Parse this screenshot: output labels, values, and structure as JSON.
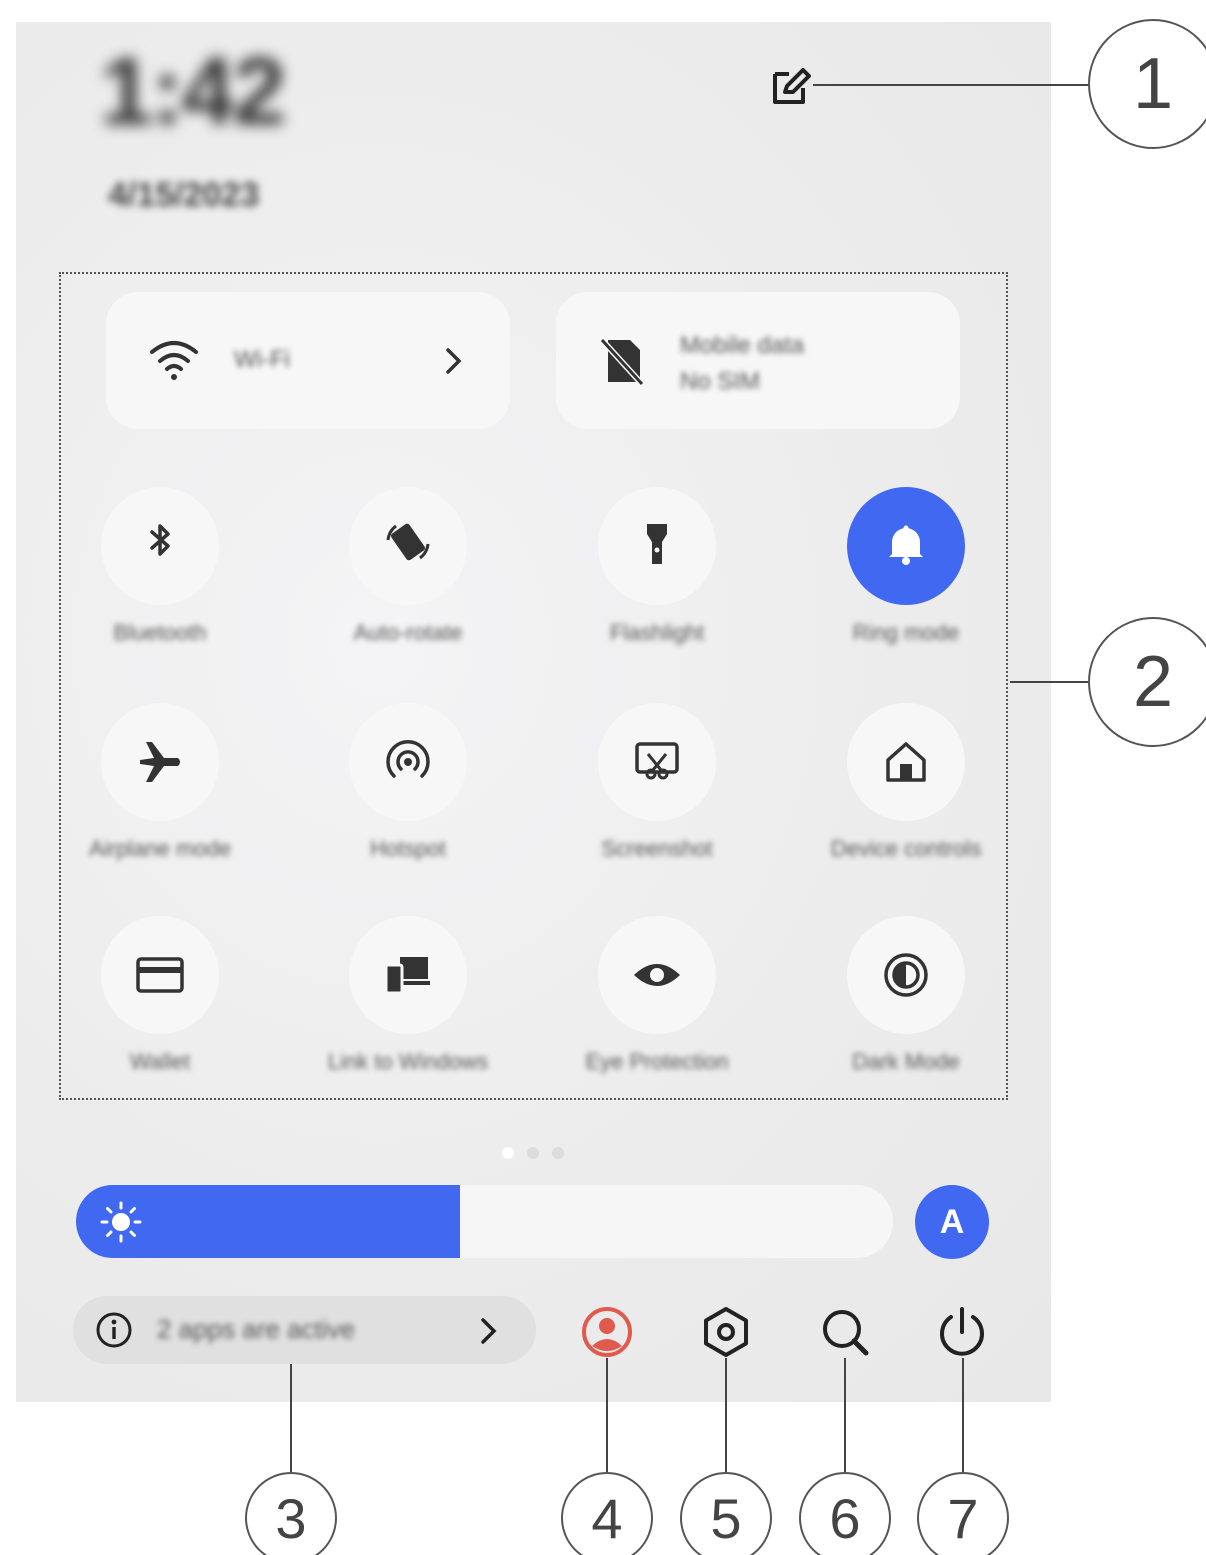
{
  "status": {
    "time": "1:42",
    "date": "4/15/2023"
  },
  "tiles": {
    "wifi": {
      "label": "Wi-Fi",
      "icon": "wifi-icon"
    },
    "mobile": {
      "line1": "Mobile data",
      "line2": "No SIM",
      "icon": "no-sim-icon"
    }
  },
  "toggles": [
    {
      "label": "Bluetooth",
      "icon": "bluetooth-icon",
      "active": false
    },
    {
      "label": "Auto-rotate",
      "icon": "auto-rotate-icon",
      "active": false
    },
    {
      "label": "Flashlight",
      "icon": "flashlight-icon",
      "active": false
    },
    {
      "label": "Ring mode",
      "icon": "bell-icon",
      "active": true
    },
    {
      "label": "Airplane mode",
      "icon": "airplane-icon",
      "active": false
    },
    {
      "label": "Hotspot",
      "icon": "hotspot-icon",
      "active": false
    },
    {
      "label": "Screenshot",
      "icon": "screenshot-icon",
      "active": false
    },
    {
      "label": "Device controls",
      "icon": "home-icon",
      "active": false
    },
    {
      "label": "Wallet",
      "icon": "wallet-icon",
      "active": false
    },
    {
      "label": "Link to Windows",
      "icon": "link-devices-icon",
      "active": false
    },
    {
      "label": "Eye Protection",
      "icon": "eye-icon",
      "active": false
    },
    {
      "label": "Dark Mode",
      "icon": "contrast-icon",
      "active": false
    }
  ],
  "pager": {
    "pages": 3,
    "current": 1
  },
  "brightness": {
    "level_percent": 47,
    "auto_label": "A"
  },
  "apps_active": {
    "text": "2 apps are active"
  },
  "bottom_icons": [
    "user-icon",
    "settings-icon",
    "search-icon",
    "power-icon"
  ],
  "callouts": [
    "1",
    "2",
    "3",
    "4",
    "5",
    "6",
    "7"
  ],
  "colors": {
    "accent": "#4168f0",
    "user_icon": "#e05a4e",
    "panel": "#ececec",
    "tile": "#f7f7f7"
  }
}
